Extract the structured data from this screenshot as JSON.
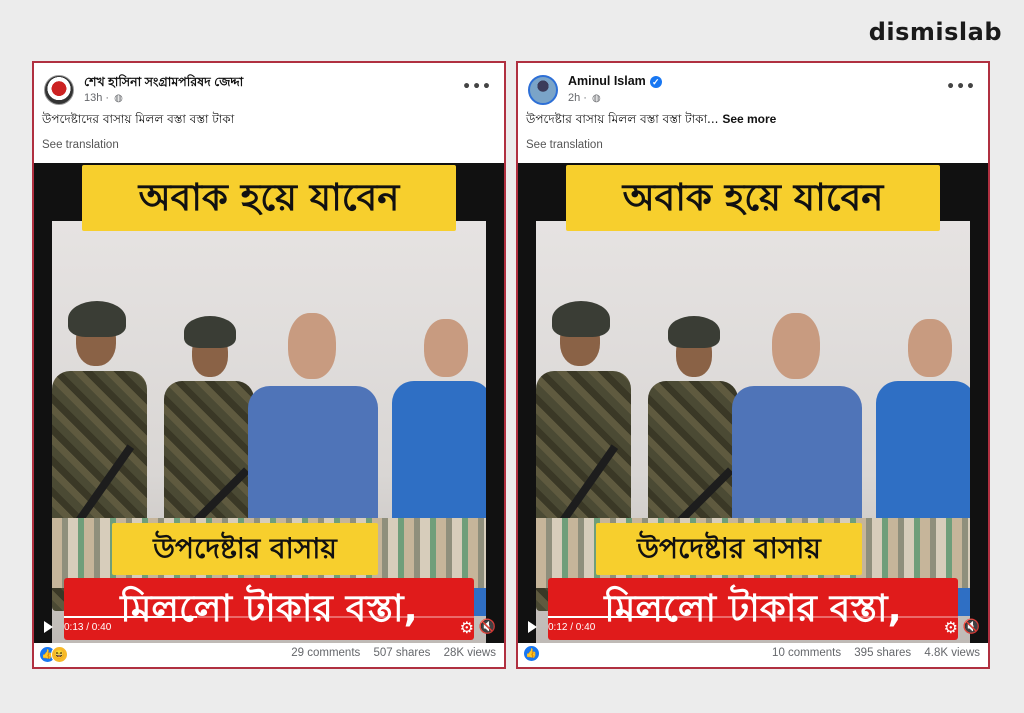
{
  "brand": {
    "name": "dismislab"
  },
  "posts": [
    {
      "author": "শেখ হাসিনা সংগ্রামপরিষদ জেদ্দা",
      "time": "13h",
      "verified": false,
      "caption": "উপদেষ্টাদের বাসায় মিলল বস্তা বস্তা টাকা",
      "see_more": "",
      "see_translation": "See translation",
      "video": {
        "title_overlay": "অবাক হয়ে যাবেন",
        "mid_overlay": "উপদেষ্টার বাসায়",
        "bottom_overlay": "মিললো টাকার বস্তা,",
        "time": "0:13 / 0:40",
        "progress": 0.325
      },
      "reactions": [
        "like-icon",
        "haha-icon"
      ],
      "stats": {
        "comments": "29 comments",
        "shares": "507 shares",
        "views": "28K views"
      }
    },
    {
      "author": "Aminul Islam",
      "time": "2h",
      "verified": true,
      "caption": "উপদেষ্টার বাসায় মিলল বস্তা বস্তা  টাকা...",
      "see_more": "See more",
      "see_translation": "See translation",
      "video": {
        "title_overlay": "অবাক হয়ে যাবেন",
        "mid_overlay": "উপদেষ্টার বাসায়",
        "bottom_overlay": "মিললো টাকার বস্তা,",
        "time": "0:12 / 0:40",
        "progress": 0.3
      },
      "reactions": [
        "like-icon"
      ],
      "stats": {
        "comments": "10 comments",
        "shares": "395 shares",
        "views": "4.8K views"
      }
    }
  ],
  "colors": {
    "frame": "#b03040",
    "banner_yellow": "#f7cf2d",
    "banner_red": "#e01b1b",
    "fb_blue": "#1877f2"
  }
}
